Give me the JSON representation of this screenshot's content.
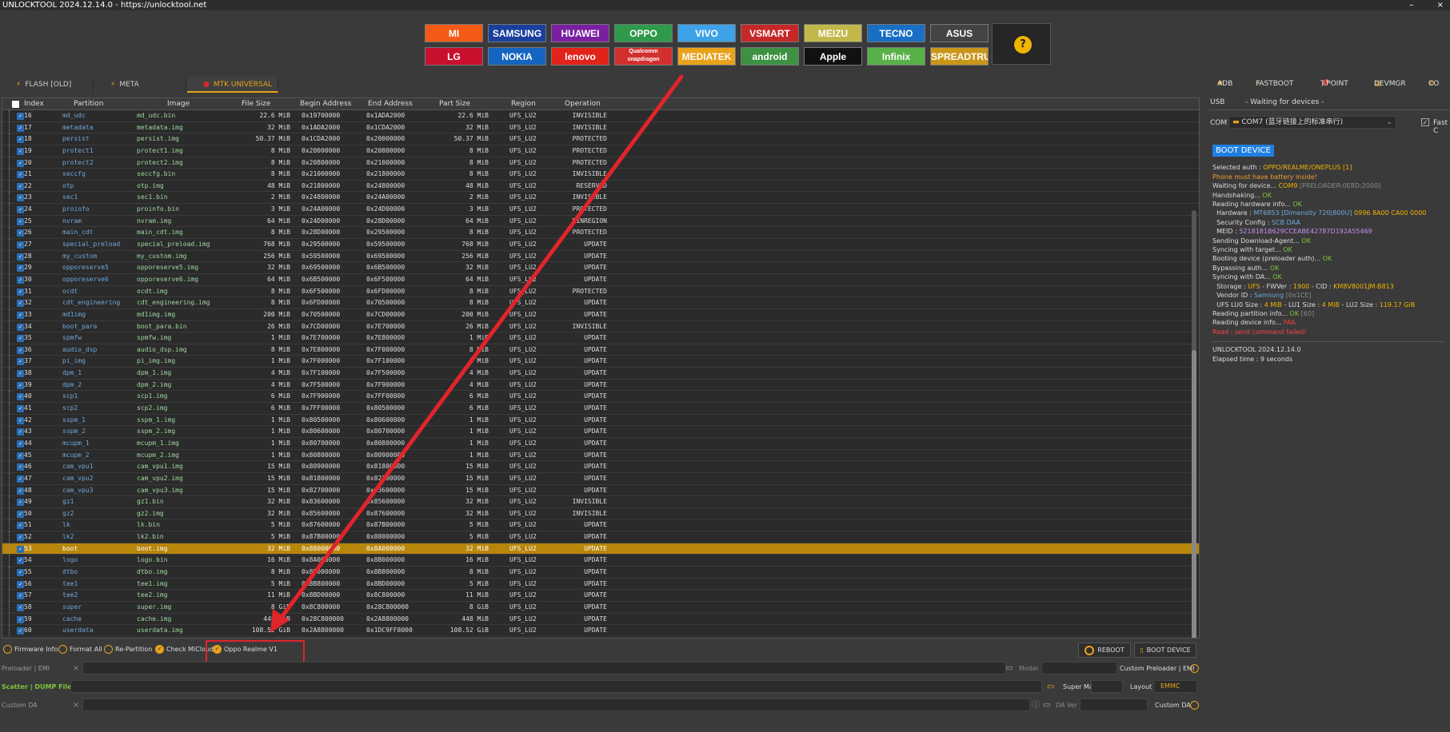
{
  "title": "UNLOCKTOOL 2024.12.14.0 - https://unlocktool.net",
  "window_controls": [
    "–",
    "×"
  ],
  "brands_row1": [
    {
      "name": "MI",
      "bg": "#f45a16"
    },
    {
      "name": "SAMSUNG",
      "bg": "#1a3f9e"
    },
    {
      "name": "HUAWEI",
      "bg": "#7b1fa2"
    },
    {
      "name": "OPPO",
      "bg": "#2f9a4b"
    },
    {
      "name": "VIVO",
      "bg": "#3ea2e8"
    },
    {
      "name": "VSMART",
      "bg": "#c62828"
    },
    {
      "name": "MEIZU",
      "bg": "#c2b84a"
    },
    {
      "name": "TECNO",
      "bg": "#1a6fc4"
    },
    {
      "name": "ASUS",
      "bg": "#444444"
    }
  ],
  "brands_row2": [
    {
      "name": "LG",
      "bg": "#c8102e"
    },
    {
      "name": "NOKIA",
      "bg": "#1565c0"
    },
    {
      "name": "lenovo",
      "bg": "#e2231a"
    },
    {
      "name": "Qualcomm snapdragon",
      "bg": "#d32f2f"
    },
    {
      "name": "MEDIATEK",
      "bg": "#e8a21a"
    },
    {
      "name": "android",
      "bg": "#3d9142"
    },
    {
      "name": "Apple",
      "bg": "#111111"
    },
    {
      "name": "Infinix",
      "bg": "#58b049"
    },
    {
      "name": "SPREADTRUM",
      "bg": "#c9961a"
    }
  ],
  "help_glyph": "?",
  "tabs": [
    {
      "label": "FLASH [OLD]"
    },
    {
      "label": "META"
    },
    {
      "label": "MTK UNIVERSAL"
    }
  ],
  "columns": [
    "Index",
    "Partition",
    "Image",
    "File Size",
    "Begin Address",
    "End Address",
    "Part Size",
    "Region",
    "Operation"
  ],
  "rows": [
    [
      "16",
      "md_udc",
      "md_udc.bin",
      "22.6 MiB",
      "0x19700000",
      "0x1ADA2000",
      "22.6 MiB",
      "UFS_LU2",
      "INVISIBLE"
    ],
    [
      "17",
      "metadata",
      "metadata.img",
      "32 MiB",
      "0x1ADA2000",
      "0x1CDA2000",
      "32 MiB",
      "UFS_LU2",
      "INVISIBLE"
    ],
    [
      "18",
      "persist",
      "persist.img",
      "50.37 MiB",
      "0x1CDA2000",
      "0x20000000",
      "50.37 MiB",
      "UFS_LU2",
      "PROTECTED"
    ],
    [
      "19",
      "protect1",
      "protect1.img",
      "8 MiB",
      "0x20000000",
      "0x20800000",
      "8 MiB",
      "UFS_LU2",
      "PROTECTED"
    ],
    [
      "20",
      "protect2",
      "protect2.img",
      "8 MiB",
      "0x20800000",
      "0x21000000",
      "8 MiB",
      "UFS_LU2",
      "PROTECTED"
    ],
    [
      "21",
      "seccfg",
      "seccfg.bin",
      "8 MiB",
      "0x21000000",
      "0x21800000",
      "8 MiB",
      "UFS_LU2",
      "INVISIBLE"
    ],
    [
      "22",
      "otp",
      "otp.img",
      "48 MiB",
      "0x21800000",
      "0x24800000",
      "48 MiB",
      "UFS_LU2",
      "RESERVED"
    ],
    [
      "23",
      "sec1",
      "sec1.bin",
      "2 MiB",
      "0x24800000",
      "0x24A00000",
      "2 MiB",
      "UFS_LU2",
      "INVISIBLE"
    ],
    [
      "24",
      "proinfo",
      "proinfo.bin",
      "3 MiB",
      "0x24A00000",
      "0x24D00000",
      "3 MiB",
      "UFS_LU2",
      "PROTECTED"
    ],
    [
      "25",
      "nvram",
      "nvram.img",
      "64 MiB",
      "0x24D00000",
      "0x28D00000",
      "64 MiB",
      "UFS_LU2",
      "BINREGION"
    ],
    [
      "26",
      "main_cdt",
      "main_cdt.img",
      "8 MiB",
      "0x28D00000",
      "0x29500000",
      "8 MiB",
      "UFS_LU2",
      "PROTECTED"
    ],
    [
      "27",
      "special_preload",
      "special_preload.img",
      "768 MiB",
      "0x29500000",
      "0x59500000",
      "768 MiB",
      "UFS_LU2",
      "UPDATE"
    ],
    [
      "28",
      "my_custom",
      "my_custom.img",
      "256 MiB",
      "0x59500000",
      "0x69500000",
      "256 MiB",
      "UFS_LU2",
      "UPDATE"
    ],
    [
      "29",
      "opporeserve5",
      "opporeserve5.img",
      "32 MiB",
      "0x69500000",
      "0x6B500000",
      "32 MiB",
      "UFS_LU2",
      "UPDATE"
    ],
    [
      "30",
      "opporeserve6",
      "opporeserve6.img",
      "64 MiB",
      "0x6B500000",
      "0x6F500000",
      "64 MiB",
      "UFS_LU2",
      "UPDATE"
    ],
    [
      "31",
      "ocdt",
      "ocdt.img",
      "8 MiB",
      "0x6F500000",
      "0x6FD00000",
      "8 MiB",
      "UFS_LU2",
      "PROTECTED"
    ],
    [
      "32",
      "cdt_engineering",
      "cdt_engineering.img",
      "8 MiB",
      "0x6FD00000",
      "0x70500000",
      "8 MiB",
      "UFS_LU2",
      "UPDATE"
    ],
    [
      "33",
      "md1img",
      "md1img.img",
      "200 MiB",
      "0x70500000",
      "0x7CD00000",
      "200 MiB",
      "UFS_LU2",
      "UPDATE"
    ],
    [
      "34",
      "boot_para",
      "boot_para.bin",
      "26 MiB",
      "0x7CD00000",
      "0x7E700000",
      "26 MiB",
      "UFS_LU2",
      "INVISIBLE"
    ],
    [
      "35",
      "spmfw",
      "spmfw.img",
      "1 MiB",
      "0x7E700000",
      "0x7E800000",
      "1 MiB",
      "UFS_LU2",
      "UPDATE"
    ],
    [
      "36",
      "audio_dsp",
      "audio_dsp.img",
      "8 MiB",
      "0x7E800000",
      "0x7F000000",
      "8 MiB",
      "UFS_LU2",
      "UPDATE"
    ],
    [
      "37",
      "pi_img",
      "pi_img.img",
      "1 MiB",
      "0x7F000000",
      "0x7F100000",
      "1 MiB",
      "UFS_LU2",
      "UPDATE"
    ],
    [
      "38",
      "dpm_1",
      "dpm_1.img",
      "4 MiB",
      "0x7F100000",
      "0x7F500000",
      "4 MiB",
      "UFS_LU2",
      "UPDATE"
    ],
    [
      "39",
      "dpm_2",
      "dpm_2.img",
      "4 MiB",
      "0x7F500000",
      "0x7F900000",
      "4 MiB",
      "UFS_LU2",
      "UPDATE"
    ],
    [
      "40",
      "scp1",
      "scp1.img",
      "6 MiB",
      "0x7F900000",
      "0x7FF00000",
      "6 MiB",
      "UFS_LU2",
      "UPDATE"
    ],
    [
      "41",
      "scp2",
      "scp2.img",
      "6 MiB",
      "0x7FF00000",
      "0x80500000",
      "6 MiB",
      "UFS_LU2",
      "UPDATE"
    ],
    [
      "42",
      "sspm_1",
      "sspm_1.img",
      "1 MiB",
      "0x80500000",
      "0x80600000",
      "1 MiB",
      "UFS_LU2",
      "UPDATE"
    ],
    [
      "43",
      "sspm_2",
      "sspm_2.img",
      "1 MiB",
      "0x80600000",
      "0x80700000",
      "1 MiB",
      "UFS_LU2",
      "UPDATE"
    ],
    [
      "44",
      "mcupm_1",
      "mcupm_1.img",
      "1 MiB",
      "0x80700000",
      "0x80800000",
      "1 MiB",
      "UFS_LU2",
      "UPDATE"
    ],
    [
      "45",
      "mcupm_2",
      "mcupm_2.img",
      "1 MiB",
      "0x80800000",
      "0x80900000",
      "1 MiB",
      "UFS_LU2",
      "UPDATE"
    ],
    [
      "46",
      "cam_vpu1",
      "cam_vpu1.img",
      "15 MiB",
      "0x80900000",
      "0x81800000",
      "15 MiB",
      "UFS_LU2",
      "UPDATE"
    ],
    [
      "47",
      "cam_vpu2",
      "cam_vpu2.img",
      "15 MiB",
      "0x81800000",
      "0x82700000",
      "15 MiB",
      "UFS_LU2",
      "UPDATE"
    ],
    [
      "48",
      "cam_vpu3",
      "cam_vpu3.img",
      "15 MiB",
      "0x82700000",
      "0x83600000",
      "15 MiB",
      "UFS_LU2",
      "UPDATE"
    ],
    [
      "49",
      "gz1",
      "gz1.bin",
      "32 MiB",
      "0x83600000",
      "0x85600000",
      "32 MiB",
      "UFS_LU2",
      "INVISIBLE"
    ],
    [
      "50",
      "gz2",
      "gz2.img",
      "32 MiB",
      "0x85600000",
      "0x87600000",
      "32 MiB",
      "UFS_LU2",
      "INVISIBLE"
    ],
    [
      "51",
      "lk",
      "lk.bin",
      "5 MiB",
      "0x87600000",
      "0x87B00000",
      "5 MiB",
      "UFS_LU2",
      "UPDATE"
    ],
    [
      "52",
      "lk2",
      "lk2.bin",
      "5 MiB",
      "0x87B00000",
      "0x88000000",
      "5 MiB",
      "UFS_LU2",
      "UPDATE"
    ],
    [
      "53",
      "boot",
      "boot.img",
      "32 MiB",
      "0x88000000",
      "0x8A000000",
      "32 MiB",
      "UFS_LU2",
      "UPDATE"
    ],
    [
      "54",
      "logo",
      "logo.bin",
      "16 MiB",
      "0x8A000000",
      "0x8B000000",
      "16 MiB",
      "UFS_LU2",
      "UPDATE"
    ],
    [
      "55",
      "dtbo",
      "dtbo.img",
      "8 MiB",
      "0x8B000000",
      "0x8B800000",
      "8 MiB",
      "UFS_LU2",
      "UPDATE"
    ],
    [
      "56",
      "tee1",
      "tee1.img",
      "5 MiB",
      "0x8B800000",
      "0x8BD00000",
      "5 MiB",
      "UFS_LU2",
      "UPDATE"
    ],
    [
      "57",
      "tee2",
      "tee2.img",
      "11 MiB",
      "0x8BD00000",
      "0x8C800000",
      "11 MiB",
      "UFS_LU2",
      "UPDATE"
    ],
    [
      "58",
      "super",
      "super.img",
      "8 GiB",
      "0x8C800000",
      "0x28C800000",
      "8 GiB",
      "UFS_LU2",
      "UPDATE"
    ],
    [
      "59",
      "cache",
      "cache.img",
      "448 MiB",
      "0x28C800000",
      "0x2A8800000",
      "448 MiB",
      "UFS_LU2",
      "UPDATE"
    ],
    [
      "60",
      "userdata",
      "userdata.img",
      "108.52 GiB",
      "0x2A8800000",
      "0x1DC9FF8000",
      "108.52 GiB",
      "UFS_LU2",
      "UPDATE"
    ]
  ],
  "selected_index": "53",
  "check_glyph": "✓",
  "options": [
    {
      "label": "Firmware Info",
      "checked": false
    },
    {
      "label": "Format All",
      "checked": false
    },
    {
      "label": "Re-Partition",
      "checked": false
    },
    {
      "label": "Check MiCloud",
      "checked": true
    },
    {
      "label": "Oppo Realme V1",
      "checked": true
    }
  ],
  "reboot_label": "REBOOT",
  "boot_device_label": "BOOT DEVICE",
  "preloader_label": "Preloader | EMI",
  "model_label": "Model",
  "custom_preloader_label": "Custom Preloader | EMI",
  "scatter_label": "Scatter | DUMP File",
  "super_map_label": "Super Map",
  "layout_label": "Layout",
  "layout_value": "EMMC",
  "custom_da_label": "Custom DA",
  "da_ver_label": "DA Ver",
  "custom_da_right_label": "Custom DA",
  "right_toolbar": [
    "ADB",
    "FASTBOOT",
    "T.POINT",
    "DEVMGR",
    "CO"
  ],
  "usb_label": "USB",
  "usb_status": "- Waiting for devices -",
  "com_label": "COM",
  "com_value": "COM7 (蓝牙链接上的标准串行)",
  "fast_label": "Fast C",
  "log_title": "BOOT DEVICE",
  "log": [
    [
      [
        "Selected auth : ",
        ""
      ],
      [
        "OPPO/REALME/ONEPLUS [1]",
        "y"
      ]
    ],
    [
      [
        "Phone must have battery inside!",
        "or"
      ]
    ],
    [
      [
        "Waiting for device... ",
        ""
      ],
      [
        "COM9 ",
        "y"
      ],
      [
        "[PRELOADER:0E8D:2000]",
        "gr"
      ]
    ],
    [
      [
        "Handshaking... ",
        ""
      ],
      [
        "OK",
        "ok"
      ]
    ],
    [
      [
        "Reading hardware info... ",
        ""
      ],
      [
        "OK",
        "ok"
      ]
    ],
    [
      [
        "  Hardware : ",
        ""
      ],
      [
        "MT6853 [Dimensity 720|800U] ",
        "bl"
      ],
      [
        "0996 8A00 CA00 0000",
        "y"
      ]
    ],
    [
      [
        "  Security Config : ",
        ""
      ],
      [
        "SCB DAA",
        "bl"
      ]
    ],
    [
      [
        "  MEID : ",
        ""
      ],
      [
        "5218181B629CCEABE42787D192A55469",
        "pu"
      ]
    ],
    [
      [
        "Sending Download-Agent... ",
        ""
      ],
      [
        "OK",
        "ok"
      ]
    ],
    [
      [
        "Syncing with target... ",
        ""
      ],
      [
        "OK",
        "ok"
      ]
    ],
    [
      [
        "Booting device (preloader auth)... ",
        ""
      ],
      [
        "OK",
        "ok"
      ]
    ],
    [
      [
        "Bypassing auth... ",
        ""
      ],
      [
        "OK",
        "ok"
      ]
    ],
    [
      [
        "Syncing with DA... ",
        ""
      ],
      [
        "OK",
        "ok"
      ]
    ],
    [
      [
        "  Storage : ",
        ""
      ],
      [
        "UFS",
        "y"
      ],
      [
        " - FWVer : ",
        ""
      ],
      [
        "1900",
        "y"
      ],
      [
        " - CID : ",
        ""
      ],
      [
        "KM8V8001JM-B813",
        "y"
      ]
    ],
    [
      [
        "  Vendor ID : ",
        ""
      ],
      [
        "Samsung ",
        "bl"
      ],
      [
        "[0x1CE]",
        "gr"
      ]
    ],
    [
      [
        "  UFS LU0 Size : ",
        ""
      ],
      [
        "4 MiB",
        "y"
      ],
      [
        " - LU1 Size : ",
        ""
      ],
      [
        "4 MiB",
        "y"
      ],
      [
        " - LU2 Size : ",
        ""
      ],
      [
        "119.17 GiB",
        "y"
      ]
    ],
    [
      [
        "Reading partition info... ",
        ""
      ],
      [
        "OK ",
        "ok"
      ],
      [
        "[60]",
        "gr"
      ]
    ],
    [
      [
        "Reading device info... ",
        ""
      ],
      [
        "FAIL",
        "r"
      ]
    ],
    [
      [
        "Read : send command failed!",
        "r"
      ]
    ]
  ],
  "log_footer_app": "UNLOCKTOOL 2024.12.14.0",
  "log_footer_elapsed": "Elapsed time : 9 seconds"
}
